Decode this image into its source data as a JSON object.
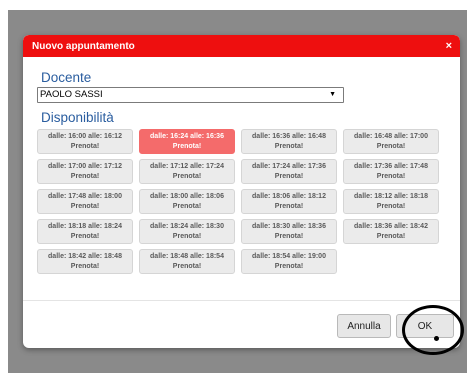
{
  "dialog": {
    "title": "Nuovo appuntamento",
    "close_symbol": "×",
    "title_bar_color": "#ee0f0f"
  },
  "docente": {
    "label": "Docente",
    "selected": "PAOLO SASSI",
    "arrow": "▼"
  },
  "disponibilita": {
    "label": "Disponibilità",
    "slots": [
      {
        "time": "dalle: 16:00 alle: 16:12",
        "action": "Prenota!",
        "selected": false
      },
      {
        "time": "dalle: 16:24 alle: 16:36",
        "action": "Prenota!",
        "selected": true
      },
      {
        "time": "dalle: 16:36 alle: 16:48",
        "action": "Prenota!",
        "selected": false
      },
      {
        "time": "dalle: 16:48 alle: 17:00",
        "action": "Prenota!",
        "selected": false
      },
      {
        "time": "dalle: 17:00 alle: 17:12",
        "action": "Prenota!",
        "selected": false
      },
      {
        "time": "dalle: 17:12 alle: 17:24",
        "action": "Prenota!",
        "selected": false
      },
      {
        "time": "dalle: 17:24 alle: 17:36",
        "action": "Prenota!",
        "selected": false
      },
      {
        "time": "dalle: 17:36 alle: 17:48",
        "action": "Prenota!",
        "selected": false
      },
      {
        "time": "dalle: 17:48 alle: 18:00",
        "action": "Prenota!",
        "selected": false
      },
      {
        "time": "dalle: 18:00 alle: 18:06",
        "action": "Prenota!",
        "selected": false
      },
      {
        "time": "dalle: 18:06 alle: 18:12",
        "action": "Prenota!",
        "selected": false
      },
      {
        "time": "dalle: 18:12 alle: 18:18",
        "action": "Prenota!",
        "selected": false
      },
      {
        "time": "dalle: 18:18 alle: 18:24",
        "action": "Prenota!",
        "selected": false
      },
      {
        "time": "dalle: 18:24 alle: 18:30",
        "action": "Prenota!",
        "selected": false
      },
      {
        "time": "dalle: 18:30 alle: 18:36",
        "action": "Prenota!",
        "selected": false
      },
      {
        "time": "dalle: 18:36 alle: 18:42",
        "action": "Prenota!",
        "selected": false
      },
      {
        "time": "dalle: 18:42 alle: 18:48",
        "action": "Prenota!",
        "selected": false
      },
      {
        "time": "dalle: 18:48 alle: 18:54",
        "action": "Prenota!",
        "selected": false
      },
      {
        "time": "dalle: 18:54 alle: 19:00",
        "action": "Prenota!",
        "selected": false
      }
    ],
    "selected_color": "#f46b6b"
  },
  "footer": {
    "cancel_label": "Annulla",
    "ok_label": "OK"
  }
}
